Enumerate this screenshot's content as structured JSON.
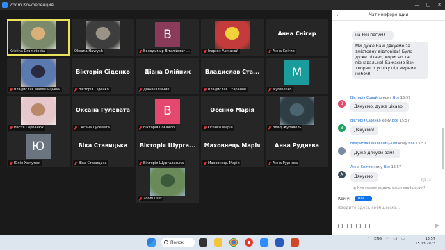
{
  "window": {
    "title": "Zoom Конференция",
    "controls": [
      "—",
      "▢",
      "✕"
    ]
  },
  "tiles": [
    {
      "type": "photo",
      "label": "Kristina Dramatecka",
      "photo": "photo-woman-blonde",
      "active": true,
      "muted": false,
      "colors": [
        "#7a8a6a",
        "#d9b07a",
        "#cfd6c8"
      ]
    },
    {
      "type": "photo",
      "label": "Oksana Havrysh",
      "photo": "photo-woman-dark-hair",
      "active": false,
      "muted": false,
      "colors": [
        "#3e3e3e",
        "#9a9488",
        "#d6d0c8"
      ]
    },
    {
      "type": "avatar",
      "label": "Володимир Віталійович...",
      "initial": "В",
      "avatar_color": "#8b3b5a",
      "muted": true
    },
    {
      "type": "photo",
      "label": "Іларіон Аржаной",
      "photo": "photo-minion",
      "active": false,
      "muted": true,
      "colors": [
        "#c43b3b",
        "#f0d23a",
        "#5a3a2a"
      ]
    },
    {
      "type": "text",
      "label": "Анна Снігир",
      "big": "Анна Снігир",
      "muted": true
    },
    {
      "type": "photo",
      "label": "Владислав Малешицький",
      "photo": "photo-man-suit",
      "active": false,
      "muted": true,
      "colors": [
        "#5a7ab0",
        "#2a2a40",
        "#d8c0a8"
      ]
    },
    {
      "type": "text",
      "label": "Вікторія Сіденко",
      "big": "Вікторія Сіденко",
      "muted": true
    },
    {
      "type": "text",
      "label": "Діана Олійник",
      "big": "Діана Олійник",
      "muted": true
    },
    {
      "type": "text",
      "label": "Владислав Старанов",
      "big": "Владислав Ста...",
      "muted": true
    },
    {
      "type": "avatar",
      "label": "Myronenko",
      "initial": "M",
      "avatar_color": "#1b9c9c",
      "muted": true
    },
    {
      "type": "photo",
      "label": "Настя Горбанюк",
      "photo": "photo-girl-pink",
      "active": false,
      "muted": true,
      "colors": [
        "#e6c8cc",
        "#b88a6a",
        "#f2e4e4"
      ]
    },
    {
      "type": "text",
      "label": "Оксана Гулевата",
      "big": "Оксана Гулевата",
      "muted": true
    },
    {
      "type": "avatar",
      "label": "Вікторія Совайло",
      "initial": "В",
      "avatar_color": "#e5486f",
      "muted": true
    },
    {
      "type": "text",
      "label": "Осенко Марія",
      "big": "Осенко Марія",
      "muted": true
    },
    {
      "type": "photo",
      "label": "Влад Журавель",
      "photo": "photo-group-dark",
      "active": false,
      "muted": true,
      "colors": [
        "#2e3e44",
        "#4c6470",
        "#8aa0a8"
      ]
    },
    {
      "type": "avatar",
      "label": "Юлія Хомутюк",
      "initial": "Ю",
      "avatar_color": "#6a7580",
      "muted": true
    },
    {
      "type": "text",
      "label": "Віка Ставицька",
      "big": "Віка Ставицька",
      "muted": true
    },
    {
      "type": "text",
      "label": "Вікторія Шургальська",
      "big": "Вікторія Шурга...",
      "muted": true
    },
    {
      "type": "text",
      "label": "Маховнець Марія",
      "big": "Маховнець Марія",
      "muted": true
    },
    {
      "type": "text",
      "label": "Анна Руднєва",
      "big": "Анна Руднєва",
      "muted": true
    },
    {
      "type": "photo",
      "label": "Zoom user",
      "photo": "photo-runner-outdoors",
      "active": false,
      "muted": true,
      "colors": [
        "#6a8a5a",
        "#3a5a3a",
        "#9ab0c8"
      ]
    }
  ],
  "chat": {
    "title": "Чат конференции",
    "messages": [
      {
        "kind": "bubble_only",
        "text": "на Неї погим!"
      },
      {
        "kind": "bubble_only",
        "text": "Ми дуже Вам дякуємо за змістовну відповідь! Було дуже цікаво, корисно та пізнавально! Бажаємо Вам творчого успіху під мирним небом!"
      },
      {
        "kind": "full",
        "initial": "В",
        "avatar_color": "#e5486f",
        "name": "Вікторія Совайло",
        "to_word": "кому",
        "to": "Все",
        "time": "15:57",
        "text": "Дякуємо, дуже цікаво"
      },
      {
        "kind": "full",
        "initial": "В",
        "avatar_color": "#20a060",
        "name": "Вікторія Сіденко",
        "to_word": "кому",
        "to": "Все",
        "time": "15:57",
        "text": "Дякуємо!"
      },
      {
        "kind": "full",
        "initial": "",
        "avatar_color": "#7a8aa0",
        "name": "Владислав Малешицький",
        "to_word": "кому",
        "to": "Все",
        "time": "15:57",
        "text": "Дуже дякуєм вам!"
      },
      {
        "kind": "full",
        "initial": "A",
        "avatar_color": "#3a4a5a",
        "name": "Анна Снігир",
        "to_word": "кому",
        "to": "Все",
        "time": "15:57",
        "text": "Дякуємо"
      }
    ],
    "who_can_see": "Кто может видеть ваши сообщения?",
    "to_label": "Кому:",
    "to_value": "Все",
    "input_placeholder": "Введите здесь сообщение..."
  },
  "taskbar": {
    "search_label": "Поиск",
    "lang": "ENG",
    "time": "15:57",
    "date": "15.03.2023"
  }
}
